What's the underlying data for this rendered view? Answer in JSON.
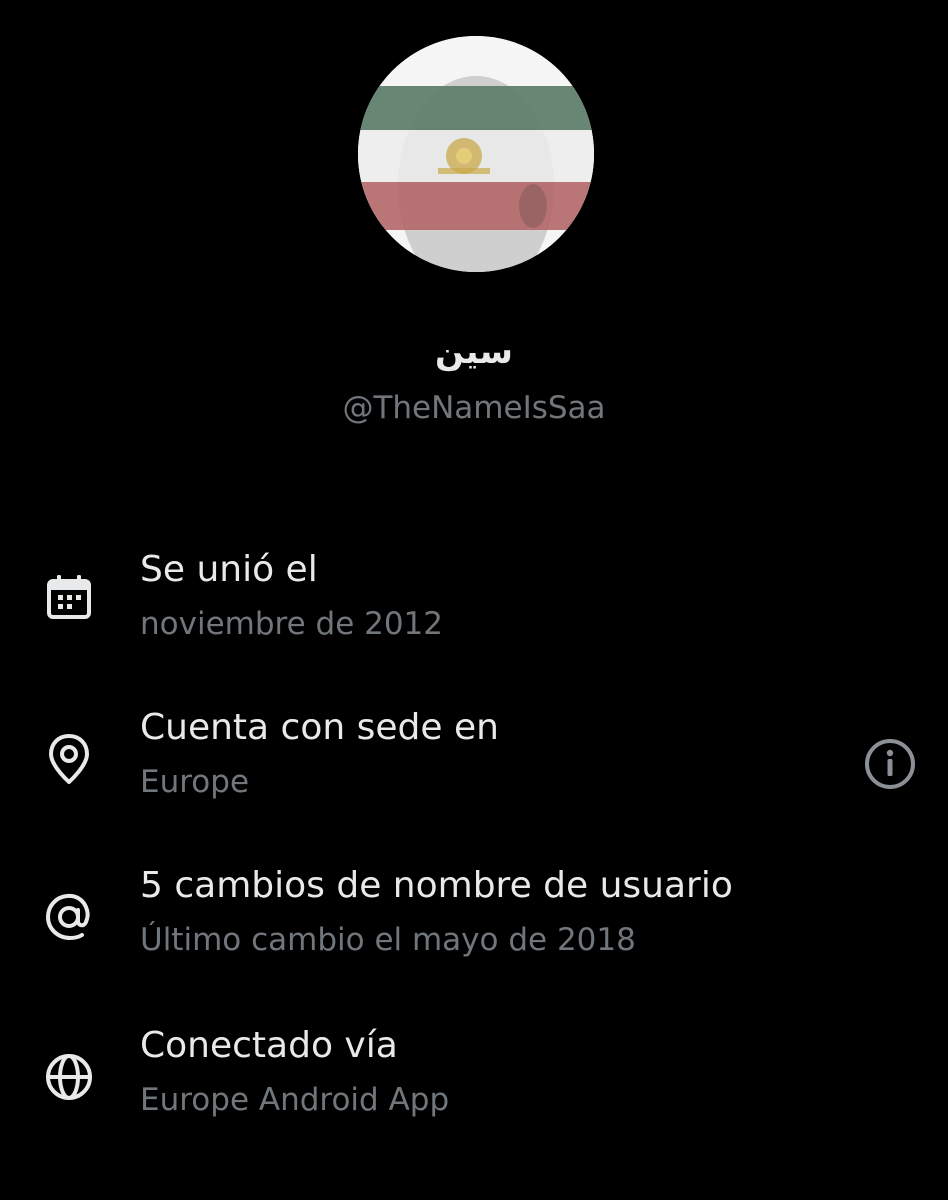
{
  "profile": {
    "display_name": "سين",
    "handle": "@TheNameIsSaa"
  },
  "about": {
    "items": [
      {
        "icon": "calendar-icon",
        "title": "Se unió el",
        "subtitle": "noviembre de 2012"
      },
      {
        "icon": "location-pin-icon",
        "title": "Cuenta con sede en",
        "subtitle": "Europe",
        "action_icon": "info-icon"
      },
      {
        "icon": "at-sign-icon",
        "title": "5 cambios de nombre de usuario",
        "subtitle": "Último cambio el mayo de 2018"
      },
      {
        "icon": "globe-icon",
        "title": "Conectado vía",
        "subtitle": "Europe Android App"
      }
    ]
  },
  "colors": {
    "background": "#000000",
    "primary_text": "#e7e9ea",
    "secondary_text": "#71767b",
    "flag_green": "#5f7f6c",
    "flag_white": "#f2f2f2",
    "flag_red": "#b46a6a"
  }
}
